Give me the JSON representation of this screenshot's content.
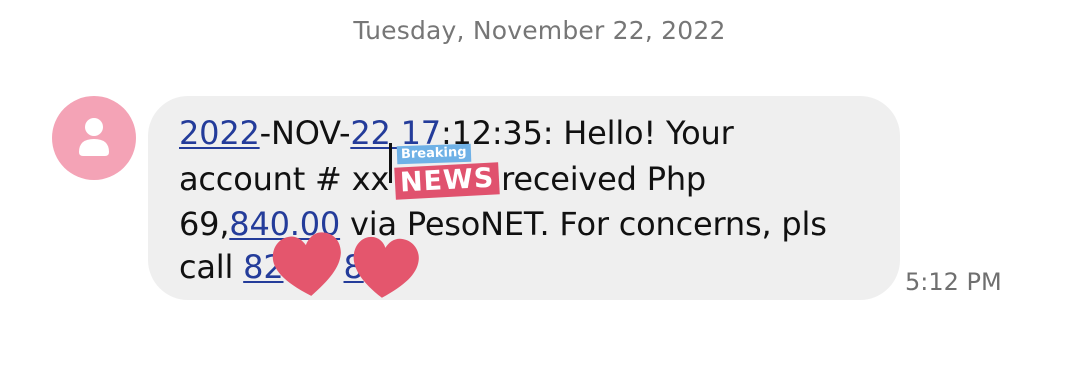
{
  "date_header": "Tuesday, November 22, 2022",
  "message": {
    "line1": {
      "link1": "2022",
      "text1": "-NOV-",
      "link2": "22 17",
      "text2": ":12:35: Hello! Your"
    },
    "line2": {
      "text1": "account # xx",
      "text2": " received Php"
    },
    "line3": {
      "text1": "69,",
      "link1": "840.00",
      "text2": " via PesoNET. For concerns, pls"
    },
    "line4": {
      "text1": "call ",
      "link1": "82",
      "link2": "8",
      "text2": "."
    }
  },
  "timestamp": "5:12 PM",
  "sticker": {
    "small": "Breaking",
    "large": "NEWS"
  },
  "icons": {
    "avatar": "person-icon",
    "stickers": [
      "breaking-news-sticker",
      "heart-sticker",
      "heart-sticker"
    ]
  },
  "colors": {
    "avatar_bg": "#f4a3b6",
    "bubble_bg": "#efefef",
    "link": "#243c9a",
    "heart": "#e4566d",
    "news": "#e0526e",
    "breaking": "#6fb1e6"
  }
}
